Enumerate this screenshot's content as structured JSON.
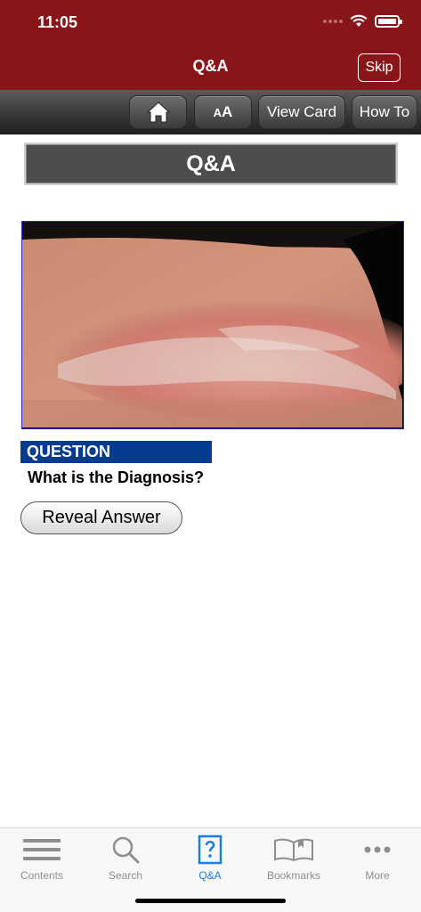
{
  "status": {
    "time": "11:05"
  },
  "nav": {
    "title": "Q&A",
    "skip_label": "Skip"
  },
  "toolbar": {
    "home_icon": "home-icon",
    "font_size_label_small": "A",
    "font_size_label_large": "A",
    "view_card_label": "View Card",
    "how_to_label": "How To"
  },
  "section": {
    "header": "Q&A"
  },
  "question": {
    "tag": "QUESTION",
    "text": "What is the Diagnosis?",
    "reveal_label": "Reveal Answer"
  },
  "tabs": [
    {
      "label": "Contents",
      "icon": "list-icon",
      "active": false
    },
    {
      "label": "Search",
      "icon": "search-icon",
      "active": false
    },
    {
      "label": "Q&A",
      "icon": "question-card-icon",
      "active": true
    },
    {
      "label": "Bookmarks",
      "icon": "book-icon",
      "active": false
    },
    {
      "label": "More",
      "icon": "more-dots-icon",
      "active": false
    }
  ],
  "colors": {
    "nav_bar": "#8a1518",
    "question_tag": "#063b8e",
    "tab_active": "#1c7ce0",
    "tab_inactive": "#8e8e8e"
  }
}
